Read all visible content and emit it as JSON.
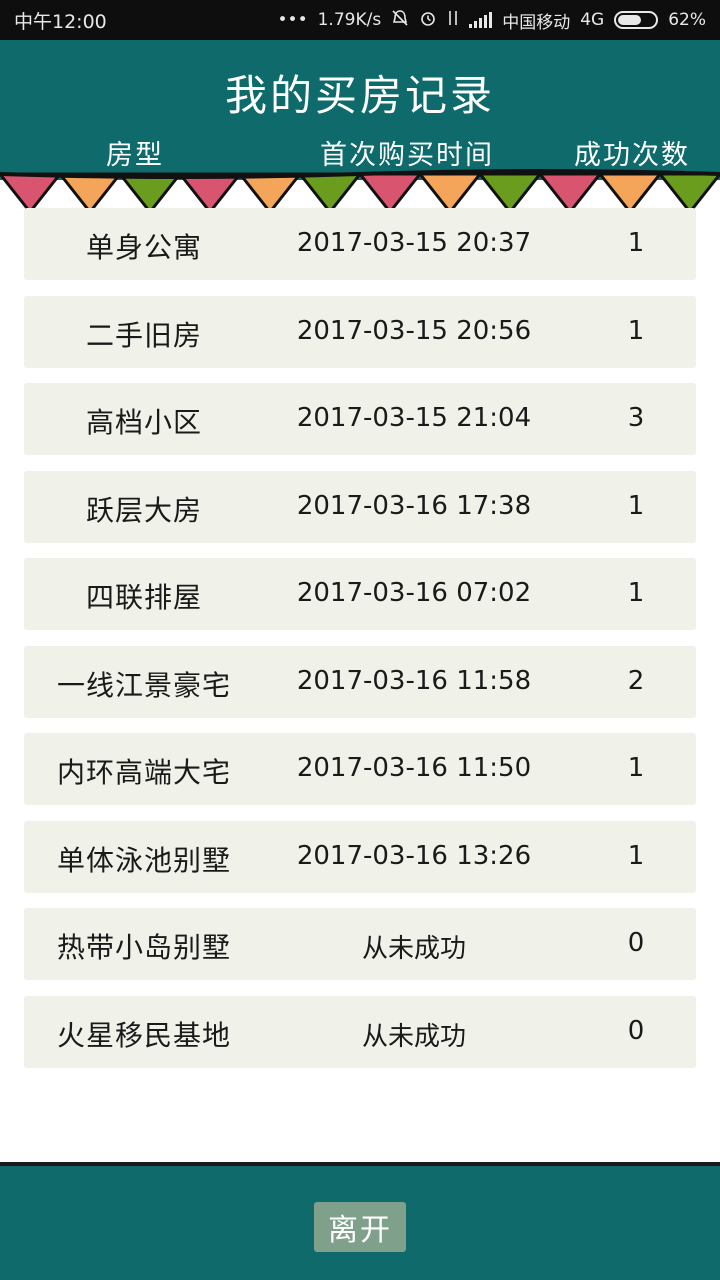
{
  "status_bar": {
    "time": "中午12:00",
    "dots": "•••",
    "speed": "1.79K/s",
    "carrier": "中国移动",
    "network": "4G",
    "battery": "62%",
    "battery_level": 0.62
  },
  "header": {
    "title": "我的买房记录",
    "columns": {
      "type": "房型",
      "time": "首次购买时间",
      "count": "成功次数"
    }
  },
  "records": [
    {
      "type": "单身公寓",
      "time": "2017-03-15 20:37",
      "count": "1"
    },
    {
      "type": "二手旧房",
      "time": "2017-03-15 20:56",
      "count": "1"
    },
    {
      "type": "高档小区",
      "time": "2017-03-15 21:04",
      "count": "3"
    },
    {
      "type": "跃层大房",
      "time": "2017-03-16 17:38",
      "count": "1"
    },
    {
      "type": "四联排屋",
      "time": "2017-03-16 07:02",
      "count": "1"
    },
    {
      "type": "一线江景豪宅",
      "time": "2017-03-16 11:58",
      "count": "2"
    },
    {
      "type": "内环高端大宅",
      "time": "2017-03-16 11:50",
      "count": "1"
    },
    {
      "type": "单体泳池别墅",
      "time": "2017-03-16 13:26",
      "count": "1"
    },
    {
      "type": "热带小岛别墅",
      "time": "从未成功",
      "count": "0"
    },
    {
      "type": "火星移民基地",
      "time": "从未成功",
      "count": "0"
    }
  ],
  "footer": {
    "leave_label": "离开"
  },
  "colors": {
    "header_bg": "#0f6b6b",
    "row_bg": "#f0f2ea",
    "button_bg": "#7fa08a",
    "flag_pink": "#d9546f",
    "flag_orange": "#f4a55a",
    "flag_green": "#6a9c1e"
  },
  "icons": [
    "mute-icon",
    "alarm-icon",
    "data-arrows-icon",
    "signal-icon",
    "battery-icon"
  ]
}
